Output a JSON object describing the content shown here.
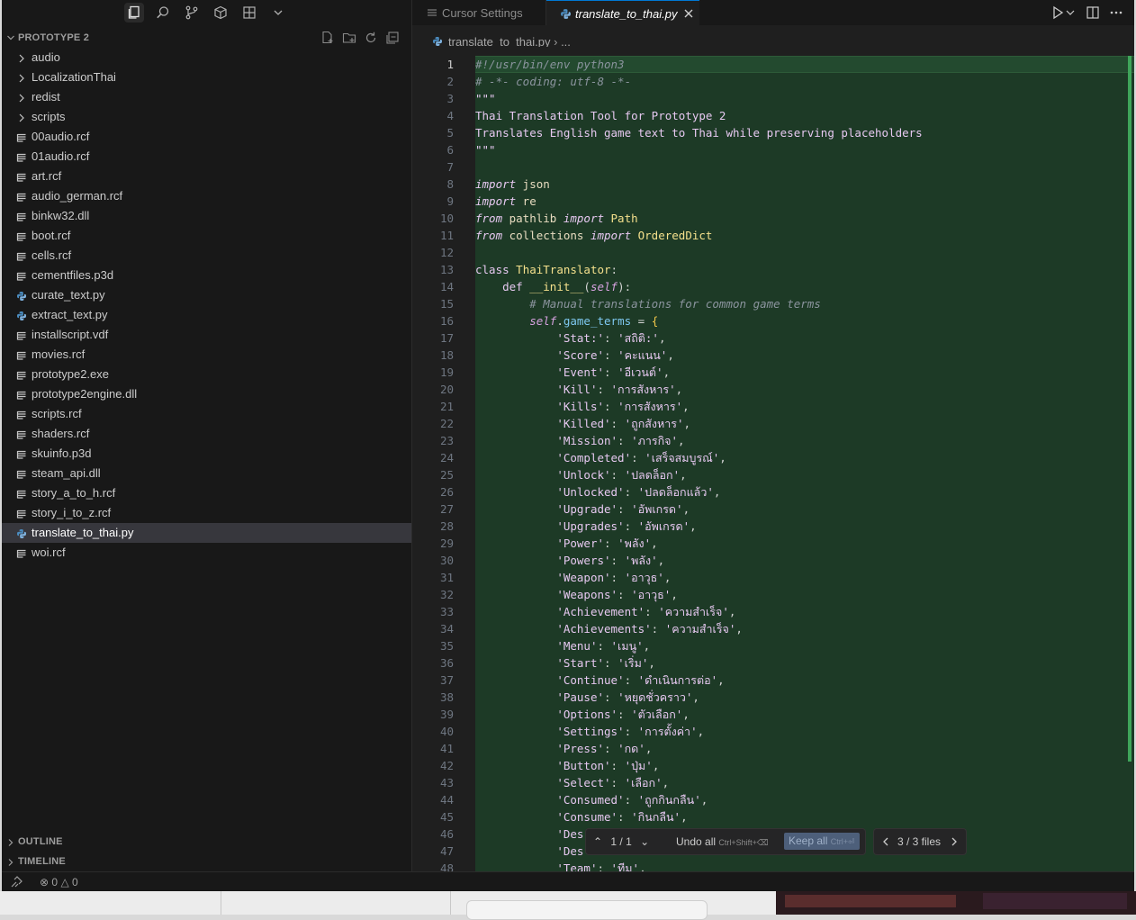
{
  "sidebar": {
    "section_title": "PROTOTYPE 2",
    "items": [
      {
        "label": "audio",
        "kind": "folder"
      },
      {
        "label": "LocalizationThai",
        "kind": "folder"
      },
      {
        "label": "redist",
        "kind": "folder"
      },
      {
        "label": "scripts",
        "kind": "folder"
      },
      {
        "label": "00audio.rcf",
        "kind": "file"
      },
      {
        "label": "01audio.rcf",
        "kind": "file"
      },
      {
        "label": "art.rcf",
        "kind": "file"
      },
      {
        "label": "audio_german.rcf",
        "kind": "file"
      },
      {
        "label": "binkw32.dll",
        "kind": "file"
      },
      {
        "label": "boot.rcf",
        "kind": "file"
      },
      {
        "label": "cells.rcf",
        "kind": "file"
      },
      {
        "label": "cementfiles.p3d",
        "kind": "file"
      },
      {
        "label": "curate_text.py",
        "kind": "python"
      },
      {
        "label": "extract_text.py",
        "kind": "python"
      },
      {
        "label": "installscript.vdf",
        "kind": "file"
      },
      {
        "label": "movies.rcf",
        "kind": "file"
      },
      {
        "label": "prototype2.exe",
        "kind": "file"
      },
      {
        "label": "prototype2engine.dll",
        "kind": "file"
      },
      {
        "label": "scripts.rcf",
        "kind": "file"
      },
      {
        "label": "shaders.rcf",
        "kind": "file"
      },
      {
        "label": "skuinfo.p3d",
        "kind": "file"
      },
      {
        "label": "steam_api.dll",
        "kind": "file"
      },
      {
        "label": "story_a_to_h.rcf",
        "kind": "file"
      },
      {
        "label": "story_i_to_z.rcf",
        "kind": "file"
      },
      {
        "label": "translate_to_thai.py",
        "kind": "python",
        "selected": true
      },
      {
        "label": "woi.rcf",
        "kind": "file"
      }
    ],
    "outline_label": "OUTLINE",
    "timeline_label": "TIMELINE"
  },
  "tabs": [
    {
      "label": "Cursor Settings",
      "active": false
    },
    {
      "label": "translate_to_thai.py",
      "active": true
    }
  ],
  "breadcrumb": {
    "file": "translate_to_thai.py",
    "rest": "..."
  },
  "editor": {
    "current_line": 1,
    "lines": [
      [
        [
          "c-com",
          "#!/usr/bin/env python3"
        ]
      ],
      [
        [
          "c-com",
          "# -*- coding: utf-8 -*-"
        ]
      ],
      [
        [
          "c-doc",
          "\"\"\""
        ]
      ],
      [
        [
          "c-doc",
          "Thai Translation Tool for Prototype 2"
        ]
      ],
      [
        [
          "c-doc",
          "Translates English game text to Thai while preserving placeholders"
        ]
      ],
      [
        [
          "c-doc",
          "\"\"\""
        ]
      ],
      [],
      [
        [
          "c-kw",
          "import"
        ],
        [
          "",
          " json"
        ]
      ],
      [
        [
          "c-kw",
          "import"
        ],
        [
          "",
          " re"
        ]
      ],
      [
        [
          "c-kw",
          "from"
        ],
        [
          "",
          " pathlib "
        ],
        [
          "c-kw",
          "import"
        ],
        [
          "c-cls",
          " Path"
        ]
      ],
      [
        [
          "c-kw",
          "from"
        ],
        [
          "",
          " collections "
        ],
        [
          "c-kw",
          "import"
        ],
        [
          "c-cls",
          " OrderedDict"
        ]
      ],
      [],
      [
        [
          "c-kw2",
          "class"
        ],
        [
          "c-cls",
          " ThaiTranslator"
        ],
        [
          "c-pun",
          ":"
        ]
      ],
      [
        [
          "",
          "    "
        ],
        [
          "c-kw2",
          "def"
        ],
        [
          "c-fn",
          " __init__"
        ],
        [
          "c-pun",
          "("
        ],
        [
          "c-self",
          "self"
        ],
        [
          "c-pun",
          "):"
        ]
      ],
      [
        [
          "",
          "        "
        ],
        [
          "c-com",
          "# Manual translations for common game terms"
        ]
      ],
      [
        [
          "",
          "        "
        ],
        [
          "c-self",
          "self"
        ],
        [
          "c-pun",
          "."
        ],
        [
          "c-attr",
          "game_terms"
        ],
        [
          "c-pun",
          " = "
        ],
        [
          "c-bracket",
          "{"
        ]
      ],
      [
        [
          "",
          "            "
        ],
        [
          "c-str",
          "'Stat:'"
        ],
        [
          "c-pun",
          ": "
        ],
        [
          "c-str",
          "'สถิติ:'"
        ],
        [
          "c-pun",
          ","
        ]
      ],
      [
        [
          "",
          "            "
        ],
        [
          "c-str",
          "'Score'"
        ],
        [
          "c-pun",
          ": "
        ],
        [
          "c-str",
          "'คะแนน'"
        ],
        [
          "c-pun",
          ","
        ]
      ],
      [
        [
          "",
          "            "
        ],
        [
          "c-str",
          "'Event'"
        ],
        [
          "c-pun",
          ": "
        ],
        [
          "c-str",
          "'อีเวนต์'"
        ],
        [
          "c-pun",
          ","
        ]
      ],
      [
        [
          "",
          "            "
        ],
        [
          "c-str",
          "'Kill'"
        ],
        [
          "c-pun",
          ": "
        ],
        [
          "c-str",
          "'การสังหาร'"
        ],
        [
          "c-pun",
          ","
        ]
      ],
      [
        [
          "",
          "            "
        ],
        [
          "c-str",
          "'Kills'"
        ],
        [
          "c-pun",
          ": "
        ],
        [
          "c-str",
          "'การสังหาร'"
        ],
        [
          "c-pun",
          ","
        ]
      ],
      [
        [
          "",
          "            "
        ],
        [
          "c-str",
          "'Killed'"
        ],
        [
          "c-pun",
          ": "
        ],
        [
          "c-str",
          "'ถูกสังหาร'"
        ],
        [
          "c-pun",
          ","
        ]
      ],
      [
        [
          "",
          "            "
        ],
        [
          "c-str",
          "'Mission'"
        ],
        [
          "c-pun",
          ": "
        ],
        [
          "c-str",
          "'ภารกิจ'"
        ],
        [
          "c-pun",
          ","
        ]
      ],
      [
        [
          "",
          "            "
        ],
        [
          "c-str",
          "'Completed'"
        ],
        [
          "c-pun",
          ": "
        ],
        [
          "c-str",
          "'เสร็จสมบูรณ์'"
        ],
        [
          "c-pun",
          ","
        ]
      ],
      [
        [
          "",
          "            "
        ],
        [
          "c-str",
          "'Unlock'"
        ],
        [
          "c-pun",
          ": "
        ],
        [
          "c-str",
          "'ปลดล็อก'"
        ],
        [
          "c-pun",
          ","
        ]
      ],
      [
        [
          "",
          "            "
        ],
        [
          "c-str",
          "'Unlocked'"
        ],
        [
          "c-pun",
          ": "
        ],
        [
          "c-str",
          "'ปลดล็อกแล้ว'"
        ],
        [
          "c-pun",
          ","
        ]
      ],
      [
        [
          "",
          "            "
        ],
        [
          "c-str",
          "'Upgrade'"
        ],
        [
          "c-pun",
          ": "
        ],
        [
          "c-str",
          "'อัพเกรด'"
        ],
        [
          "c-pun",
          ","
        ]
      ],
      [
        [
          "",
          "            "
        ],
        [
          "c-str",
          "'Upgrades'"
        ],
        [
          "c-pun",
          ": "
        ],
        [
          "c-str",
          "'อัพเกรด'"
        ],
        [
          "c-pun",
          ","
        ]
      ],
      [
        [
          "",
          "            "
        ],
        [
          "c-str",
          "'Power'"
        ],
        [
          "c-pun",
          ": "
        ],
        [
          "c-str",
          "'พลัง'"
        ],
        [
          "c-pun",
          ","
        ]
      ],
      [
        [
          "",
          "            "
        ],
        [
          "c-str",
          "'Powers'"
        ],
        [
          "c-pun",
          ": "
        ],
        [
          "c-str",
          "'พลัง'"
        ],
        [
          "c-pun",
          ","
        ]
      ],
      [
        [
          "",
          "            "
        ],
        [
          "c-str",
          "'Weapon'"
        ],
        [
          "c-pun",
          ": "
        ],
        [
          "c-str",
          "'อาวุธ'"
        ],
        [
          "c-pun",
          ","
        ]
      ],
      [
        [
          "",
          "            "
        ],
        [
          "c-str",
          "'Weapons'"
        ],
        [
          "c-pun",
          ": "
        ],
        [
          "c-str",
          "'อาวุธ'"
        ],
        [
          "c-pun",
          ","
        ]
      ],
      [
        [
          "",
          "            "
        ],
        [
          "c-str",
          "'Achievement'"
        ],
        [
          "c-pun",
          ": "
        ],
        [
          "c-str",
          "'ความสำเร็จ'"
        ],
        [
          "c-pun",
          ","
        ]
      ],
      [
        [
          "",
          "            "
        ],
        [
          "c-str",
          "'Achievements'"
        ],
        [
          "c-pun",
          ": "
        ],
        [
          "c-str",
          "'ความสำเร็จ'"
        ],
        [
          "c-pun",
          ","
        ]
      ],
      [
        [
          "",
          "            "
        ],
        [
          "c-str",
          "'Menu'"
        ],
        [
          "c-pun",
          ": "
        ],
        [
          "c-str",
          "'เมนู'"
        ],
        [
          "c-pun",
          ","
        ]
      ],
      [
        [
          "",
          "            "
        ],
        [
          "c-str",
          "'Start'"
        ],
        [
          "c-pun",
          ": "
        ],
        [
          "c-str",
          "'เริ่ม'"
        ],
        [
          "c-pun",
          ","
        ]
      ],
      [
        [
          "",
          "            "
        ],
        [
          "c-str",
          "'Continue'"
        ],
        [
          "c-pun",
          ": "
        ],
        [
          "c-str",
          "'ดำเนินการต่อ'"
        ],
        [
          "c-pun",
          ","
        ]
      ],
      [
        [
          "",
          "            "
        ],
        [
          "c-str",
          "'Pause'"
        ],
        [
          "c-pun",
          ": "
        ],
        [
          "c-str",
          "'หยุดชั่วคราว'"
        ],
        [
          "c-pun",
          ","
        ]
      ],
      [
        [
          "",
          "            "
        ],
        [
          "c-str",
          "'Options'"
        ],
        [
          "c-pun",
          ": "
        ],
        [
          "c-str",
          "'ตัวเลือก'"
        ],
        [
          "c-pun",
          ","
        ]
      ],
      [
        [
          "",
          "            "
        ],
        [
          "c-str",
          "'Settings'"
        ],
        [
          "c-pun",
          ": "
        ],
        [
          "c-str",
          "'การตั้งค่า'"
        ],
        [
          "c-pun",
          ","
        ]
      ],
      [
        [
          "",
          "            "
        ],
        [
          "c-str",
          "'Press'"
        ],
        [
          "c-pun",
          ": "
        ],
        [
          "c-str",
          "'กด'"
        ],
        [
          "c-pun",
          ","
        ]
      ],
      [
        [
          "",
          "            "
        ],
        [
          "c-str",
          "'Button'"
        ],
        [
          "c-pun",
          ": "
        ],
        [
          "c-str",
          "'ปุ่ม'"
        ],
        [
          "c-pun",
          ","
        ]
      ],
      [
        [
          "",
          "            "
        ],
        [
          "c-str",
          "'Select'"
        ],
        [
          "c-pun",
          ": "
        ],
        [
          "c-str",
          "'เลือก'"
        ],
        [
          "c-pun",
          ","
        ]
      ],
      [
        [
          "",
          "            "
        ],
        [
          "c-str",
          "'Consumed'"
        ],
        [
          "c-pun",
          ": "
        ],
        [
          "c-str",
          "'ถูกกินกลืน'"
        ],
        [
          "c-pun",
          ","
        ]
      ],
      [
        [
          "",
          "            "
        ],
        [
          "c-str",
          "'Consume'"
        ],
        [
          "c-pun",
          ": "
        ],
        [
          "c-str",
          "'กินกลืน'"
        ],
        [
          "c-pun",
          ","
        ]
      ],
      [
        [
          "",
          "            "
        ],
        [
          "c-str",
          "'Des"
        ]
      ],
      [
        [
          "",
          "            "
        ],
        [
          "c-str",
          "'Des"
        ]
      ],
      [
        [
          "",
          "            "
        ],
        [
          "c-str",
          "'Team'"
        ],
        [
          "c-pun",
          ": "
        ],
        [
          "c-str",
          "'ทีม'"
        ],
        [
          "c-pun",
          ","
        ]
      ]
    ]
  },
  "review": {
    "counter": "1 / 1",
    "undo_label": "Undo all",
    "undo_shortcut": "Ctrl+Shift+⌫",
    "keep_label": "Keep all",
    "keep_shortcut": "Ctrl+⏎",
    "files_label": "3 / 3 files"
  },
  "status": {
    "errors": "0",
    "warnings": "0"
  }
}
